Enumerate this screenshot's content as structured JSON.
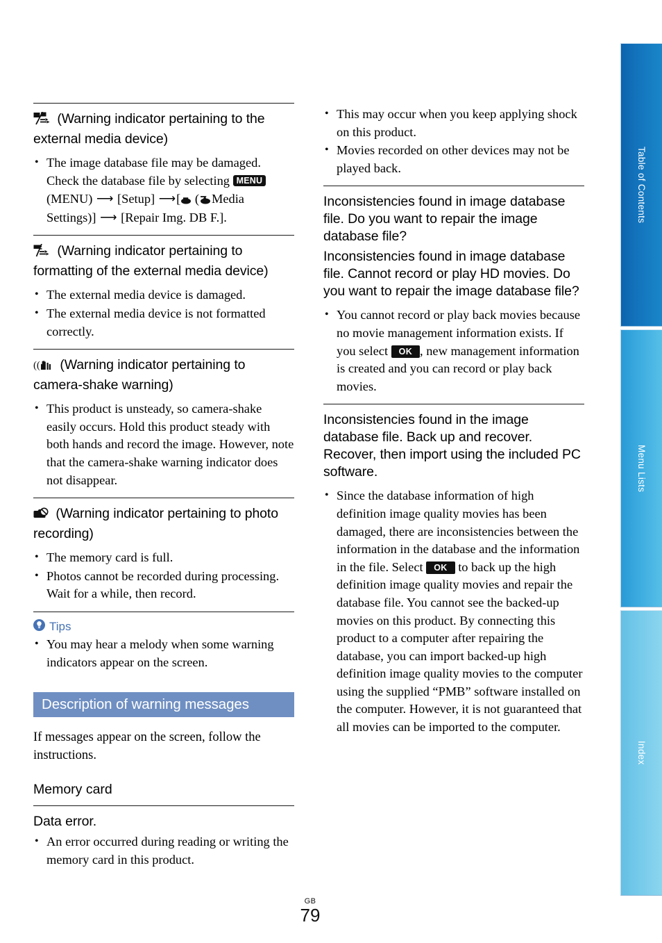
{
  "page": {
    "number": "79",
    "region_code": "GB"
  },
  "side_tabs": [
    {
      "label": "Table of Contents",
      "color": "#1272bb"
    },
    {
      "label": "Menu Lists",
      "color": "#3aaadf"
    },
    {
      "label": "Index",
      "color": "#74c9ea"
    }
  ],
  "left_column": {
    "entry_external_media": {
      "heading": "(Warning indicator pertaining to the external media device)",
      "icon": "external-media-warning-icon",
      "bullets_pre": "The image database file may be damaged. Check the database file by selecting",
      "chip_menu": "MENU",
      "bullets_mid": "(MENU)",
      "bullets_setup": "[Setup]",
      "bullets_media": "Media Settings)]",
      "bullets_repair": "[Repair Img. DB F.]."
    },
    "entry_format_media": {
      "heading": "(Warning indicator pertaining to formatting of the external media device)",
      "icon": "external-media-format-warning-icon",
      "bullets": [
        "The external media device is damaged.",
        "The external media device is not formatted correctly."
      ]
    },
    "entry_camera_shake": {
      "heading": "(Warning indicator pertaining to camera-shake warning)",
      "icon": "camera-shake-warning-icon",
      "bullets": [
        "This product is unsteady, so camera-shake easily occurs. Hold this product steady with both hands and record the image. However, note that the camera-shake warning indicator does not disappear."
      ]
    },
    "entry_photo_recording": {
      "heading": "(Warning indicator pertaining to photo recording)",
      "icon": "photo-recording-warning-icon",
      "bullets": [
        "The memory card is full.",
        "Photos cannot be recorded during processing. Wait for a while, then record."
      ]
    },
    "tips": {
      "label": "Tips",
      "icon": "tips-lightbulb-icon",
      "bullets": [
        "You may hear a melody when some warning indicators appear on the screen."
      ]
    },
    "section": {
      "title": "Description of warning messages",
      "intro": "If messages appear on the screen, follow the instructions.",
      "subsection_title": "Memory card",
      "message_data_error": {
        "heading": "Data error.",
        "bullets": [
          "An error occurred during reading or writing the memory card in this product."
        ]
      }
    }
  },
  "right_column": {
    "continued_bullets": [
      "This may occur when you keep applying shock on this product.",
      "Movies recorded on other devices may not be played back."
    ],
    "message_repair_db": {
      "heading_line_1": "Inconsistencies found in image database file. Do you want to repair the image database file?",
      "heading_line_2": "Inconsistencies found in image database file. Cannot record or play HD movies. Do you want to repair the image database file?",
      "bullet_pre": "You cannot record or play back movies because no movie management information exists. If you select",
      "chip_ok": "OK",
      "bullet_post": ", new management information is created and you can record or play back movies."
    },
    "message_backup_recover": {
      "heading": "Inconsistencies found in the image database file. Back up and recover. Recover, then import using the included PC software.",
      "bullet_pre": "Since the database information of high definition image quality movies has been damaged, there are inconsistencies between the information in the database and the information in the file. Select",
      "chip_ok": "OK",
      "bullet_post": "to back up the high definition image quality movies and repair the database file. You cannot see the backed-up movies on this product. By connecting this product to a computer after repairing the database, you can import backed-up high definition image quality movies to the computer using the supplied “PMB” software installed on the computer. However, it is not guaranteed that all movies can be imported to the computer."
    }
  }
}
